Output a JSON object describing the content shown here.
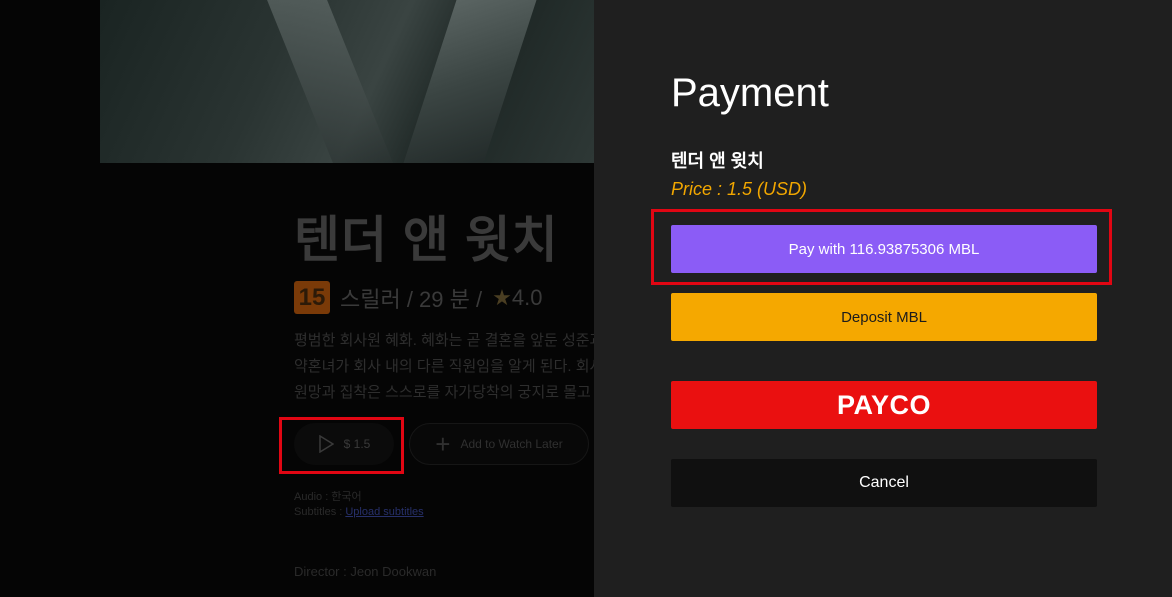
{
  "background_page": {
    "title": "텐더 앤 윗치",
    "age_rating": "15",
    "meta": "스릴러 / 29 분 /",
    "rating": "4.0",
    "synopsis_lines": [
      "평범한 회사원 혜화. 혜화는 곧 결혼을 앞둔 성준과",
      "약혼녀가 회사 내의 다른 직원임을 알게 된다. 회사",
      "원망과 집착은 스스로를 자가당착의 궁지로 몰고"
    ],
    "play_price": "$ 1.5",
    "watch_later_label": "Add to Watch Later",
    "audio_label": "Audio : 한국어",
    "subtitles_label": "Subtitles : ",
    "subtitles_link": "Upload subtitles",
    "director": "Director : Jeon Dookwan"
  },
  "payment": {
    "title": "Payment",
    "movie_title": "텐더 앤 윗치",
    "price": "Price : 1.5 (USD)",
    "pay_mbl_label": "Pay with 116.93875306 MBL",
    "deposit_label": "Deposit MBL",
    "payco_label": "PAYCO",
    "cancel_label": "Cancel"
  },
  "colors": {
    "mbl_button": "#8b5cf6",
    "deposit_button": "#f5a800",
    "payco_button": "#ea1010",
    "price_text": "#f2a700",
    "highlight_box": "#e10613"
  },
  "icons": {
    "play": "play-icon",
    "plus": "plus-icon",
    "star": "star-icon"
  }
}
